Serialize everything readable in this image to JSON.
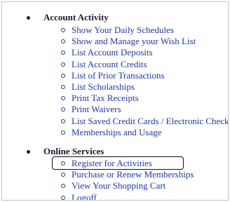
{
  "sections": [
    {
      "title": "Account Activity",
      "items": [
        "Show Your Daily Schedules",
        "Show and Manage your Wish List",
        "List Account Deposits",
        "List Account Credits",
        "List of Prior Transactions",
        "List Scholarships",
        "Print Tax Receipts",
        "Print Waivers",
        "List Saved Credit Cards / Electronic Checks",
        "Memberships and Usage"
      ]
    },
    {
      "title": "Online Services",
      "items": [
        "Register for Activities",
        "Purchase or Renew Memberships",
        "View Your Shopping Cart",
        "Logoff"
      ]
    }
  ],
  "highlighted_item": "Register for Activities",
  "colors": {
    "link": "#1d3a9e",
    "heading": "#1a1a2e",
    "highlight_border": "#111111"
  }
}
